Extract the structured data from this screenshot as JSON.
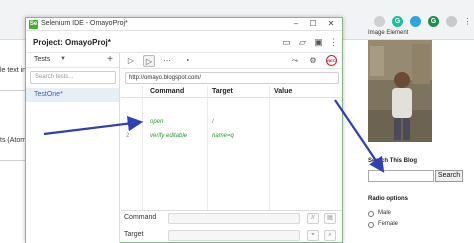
{
  "ide": {
    "window_title": "Selenium IDE - OmayoProj*",
    "project_label": "Project:  OmayoProj*",
    "tests_label": "Tests",
    "tests_plus": "+",
    "search_placeholder": "Search tests...",
    "test_item": "TestOne*",
    "url": "http://omayo.blogspot.com/",
    "table_headers": {
      "command": "Command",
      "target": "Target",
      "value": "Value"
    },
    "rows": [
      {
        "num": "1",
        "command": "open",
        "target": "/"
      },
      {
        "num": "2",
        "command": "verify editable",
        "target": "name=q"
      }
    ],
    "editor": {
      "command_label": "Command",
      "target_label": "Target"
    },
    "icons": {
      "title": "selenium-icon",
      "project": [
        "folder-new-icon",
        "folder-open-icon",
        "save-icon",
        "more-icon"
      ],
      "toolbar": [
        "run-all-icon",
        "run-icon",
        "step-icon",
        "speed-icon"
      ],
      "right": [
        "disable-breakpoints-icon",
        "pause-icon",
        "record-icon"
      ]
    },
    "rec_text": "REC"
  },
  "background": {
    "left_snippets": [
      "le text in",
      "ts (Atom)"
    ],
    "image_heading": "Image Element",
    "search_label": "Search This Blog",
    "search_button": "Search",
    "radio_title": "Radio options",
    "radio_options": [
      "Male",
      "Female"
    ],
    "ext_labels": [
      "G",
      "G"
    ]
  },
  "colors": {
    "green_command": "#2e9b2e",
    "arrow": "#2f3fb5",
    "selected_test": "#e8eef6",
    "rec": "#c62828"
  }
}
